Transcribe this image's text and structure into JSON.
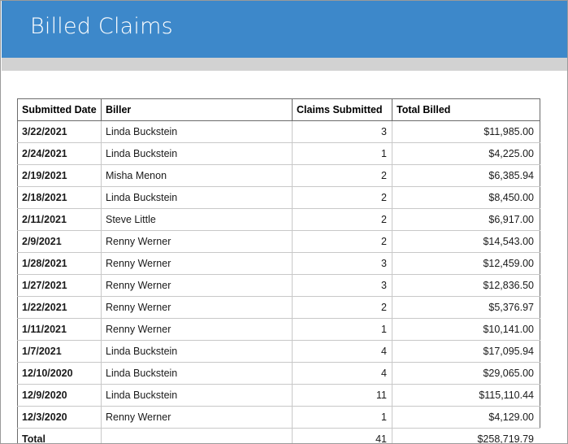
{
  "header": {
    "title": "Billed Claims",
    "banner_color": "#3d88ca",
    "subband_color": "#d2d2d2",
    "title_color": "#ffffff"
  },
  "table": {
    "columns": [
      {
        "key": "submitted_date",
        "label": "Submitted Date",
        "align": "left"
      },
      {
        "key": "biller",
        "label": "Biller",
        "align": "left"
      },
      {
        "key": "claims_submitted",
        "label": "Claims Submitted",
        "align": "right"
      },
      {
        "key": "total_billed",
        "label": "Total Billed",
        "align": "right"
      }
    ],
    "rows": [
      {
        "submitted_date": "3/22/2021",
        "biller": "Linda Buckstein",
        "claims_submitted": "3",
        "total_billed": "$11,985.00"
      },
      {
        "submitted_date": "2/24/2021",
        "biller": "Linda Buckstein",
        "claims_submitted": "1",
        "total_billed": "$4,225.00"
      },
      {
        "submitted_date": "2/19/2021",
        "biller": "Misha Menon",
        "claims_submitted": "2",
        "total_billed": "$6,385.94"
      },
      {
        "submitted_date": "2/18/2021",
        "biller": "Linda Buckstein",
        "claims_submitted": "2",
        "total_billed": "$8,450.00"
      },
      {
        "submitted_date": "2/11/2021",
        "biller": "Steve Little",
        "claims_submitted": "2",
        "total_billed": "$6,917.00"
      },
      {
        "submitted_date": "2/9/2021",
        "biller": "Renny Werner",
        "claims_submitted": "2",
        "total_billed": "$14,543.00"
      },
      {
        "submitted_date": "1/28/2021",
        "biller": "Renny Werner",
        "claims_submitted": "3",
        "total_billed": "$12,459.00"
      },
      {
        "submitted_date": "1/27/2021",
        "biller": "Renny Werner",
        "claims_submitted": "3",
        "total_billed": "$12,836.50"
      },
      {
        "submitted_date": "1/22/2021",
        "biller": "Renny Werner",
        "claims_submitted": "2",
        "total_billed": "$5,376.97"
      },
      {
        "submitted_date": "1/11/2021",
        "biller": "Renny Werner",
        "claims_submitted": "1",
        "total_billed": "$10,141.00"
      },
      {
        "submitted_date": "1/7/2021",
        "biller": "Linda Buckstein",
        "claims_submitted": "4",
        "total_billed": "$17,095.94"
      },
      {
        "submitted_date": "12/10/2020",
        "biller": "Linda Buckstein",
        "claims_submitted": "4",
        "total_billed": "$29,065.00"
      },
      {
        "submitted_date": "12/9/2020",
        "biller": "Linda Buckstein",
        "claims_submitted": "11",
        "total_billed": "$115,110.44"
      },
      {
        "submitted_date": "12/3/2020",
        "biller": "Renny Werner",
        "claims_submitted": "1",
        "total_billed": "$4,129.00"
      }
    ],
    "total_row": {
      "submitted_date": "Total",
      "biller": "",
      "claims_submitted": "41",
      "total_billed": "$258,719.79"
    }
  }
}
